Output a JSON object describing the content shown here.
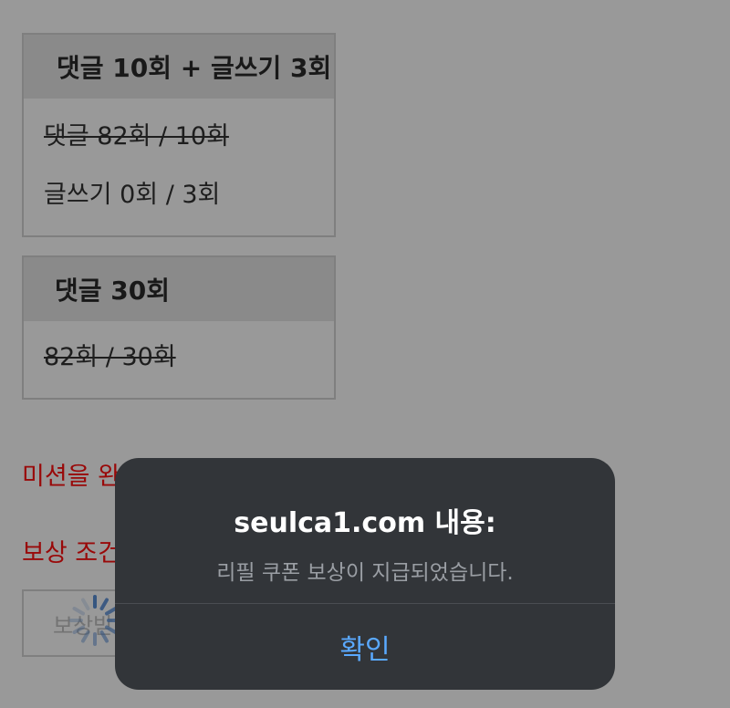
{
  "missions": [
    {
      "title": "댓글 10회 + 글쓰기 3회",
      "rows": [
        "댓글 82회 / 10회",
        "글쓰기 0회 / 3회"
      ]
    },
    {
      "title": "댓글 30회",
      "rows": [
        "82회 / 30회"
      ]
    }
  ],
  "notices": {
    "line1": "미션을 완",
    "line2": "보상 조건"
  },
  "reward_button": {
    "label": "보상받기"
  },
  "dialog": {
    "title": "seulca1.com 내용:",
    "message": "리필 쿠폰 보상이 지급되었습니다.",
    "confirm_label": "확인"
  },
  "colors": {
    "notice_text": "#ff1010",
    "dialog_background": "#323539",
    "confirm_text": "#5aa9ff"
  }
}
